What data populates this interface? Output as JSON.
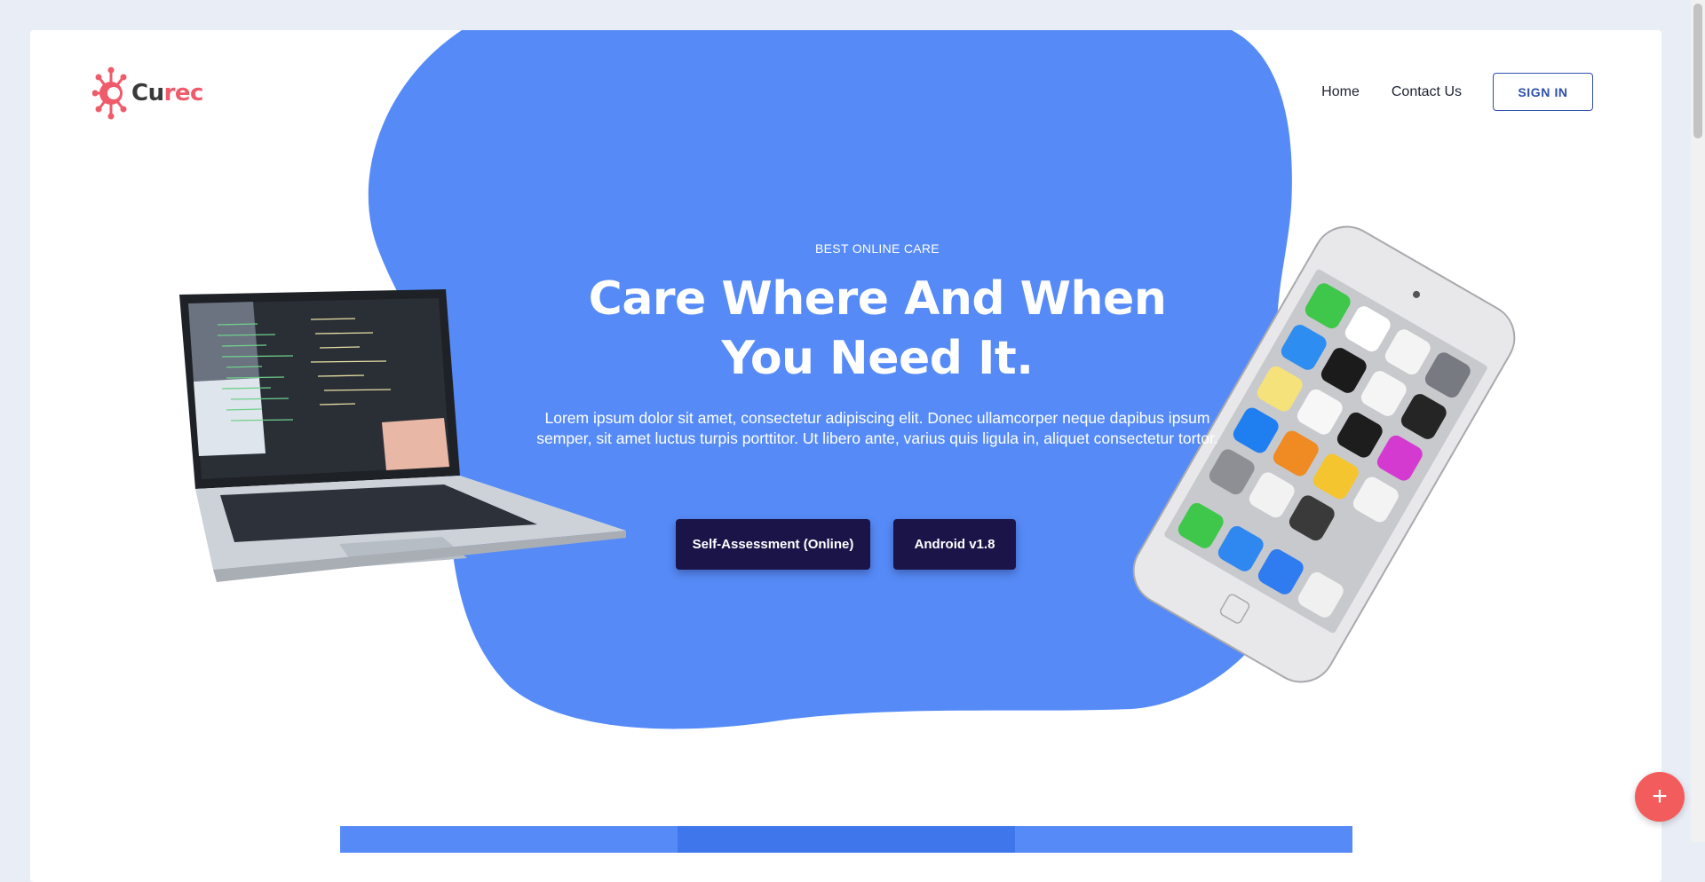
{
  "brand": {
    "logo_icon": "virus-icon",
    "name_part1": "Cu",
    "name_part2": "rec",
    "accent": "#ef5b6b"
  },
  "nav": {
    "links": [
      "Home",
      "Contact Us"
    ],
    "signin_label": "SIGN IN"
  },
  "hero": {
    "eyebrow": "BEST ONLINE CARE",
    "title_line1": "Care Where And When",
    "title_line2": "You Need It.",
    "body": "Lorem ipsum dolor sit amet, consectetur adipiscing elit. Donec ullamcorper neque dapibus ipsum semper, sit amet luctus turpis porttitor. Ut libero ante, varius quis ligula in, aliquet consectetur tortor.",
    "buttons": [
      "Self-Assessment (Online)",
      "Android v1.8"
    ]
  },
  "fab_icon": "plus-icon",
  "colors": {
    "blob": "#568bf7",
    "button": "#1a1449",
    "fab": "#f25c5c",
    "page_bg": "#e9edf6",
    "nav_border": "#2c4fa8"
  }
}
